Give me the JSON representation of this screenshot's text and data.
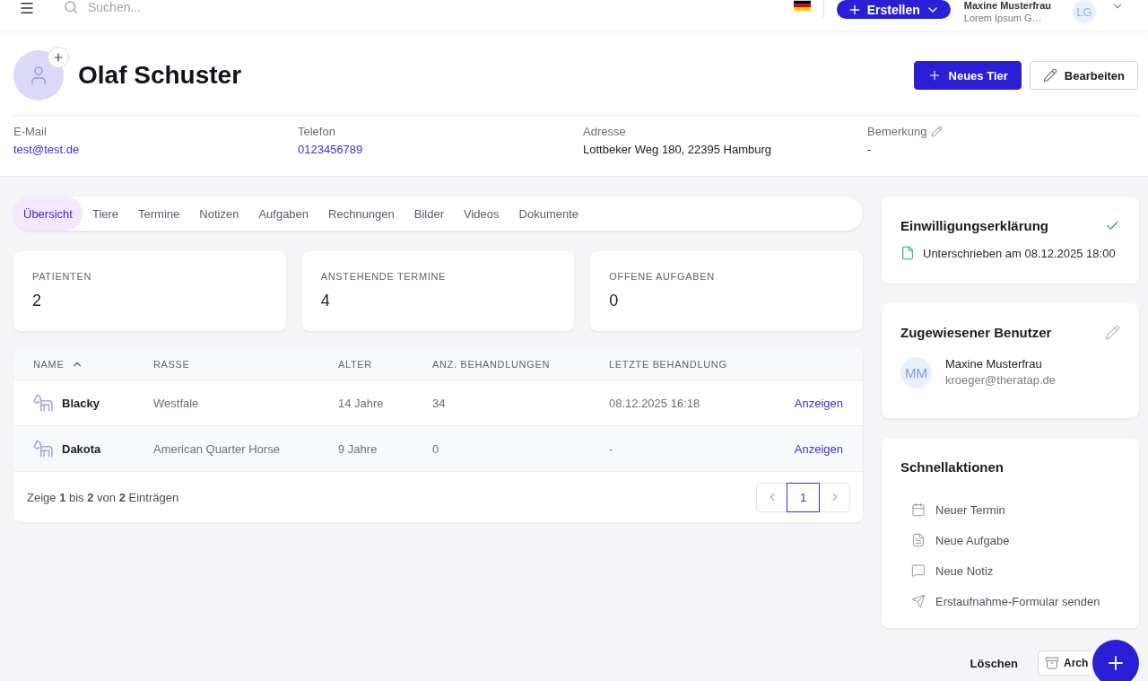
{
  "top_bar": {
    "search": {
      "placeholder": "Suchen..."
    },
    "create_button": "Erstellen",
    "user": {
      "name": "Maxine Musterfrau",
      "organization": "Lorem Ipsum G…",
      "initials": "LG"
    }
  },
  "client": {
    "name": "Olaf Schuster",
    "buttons": [
      {
        "label": "Neues Tier",
        "kind": "primary"
      },
      {
        "label": "Bearbeiten",
        "kind": "secondary"
      }
    ],
    "fields": [
      {
        "label": "E-Mail",
        "value": "test@test.de",
        "kind": "link",
        "editable": false
      },
      {
        "label": "Telefon",
        "value": "0123456789",
        "kind": "link",
        "editable": false
      },
      {
        "label": "Adresse",
        "value": "Lottbeker Weg 180, 22395 Hamburg",
        "kind": "text",
        "editable": false
      },
      {
        "label": "Bemerkung",
        "value": "-",
        "kind": "text",
        "editable": true
      }
    ]
  },
  "tabs": [
    {
      "label": "Übersicht",
      "selected": true
    },
    {
      "label": "Tiere",
      "selected": false
    },
    {
      "label": "Termine",
      "selected": false
    },
    {
      "label": "Notizen",
      "selected": false
    },
    {
      "label": "Aufgaben",
      "selected": false
    },
    {
      "label": "Rechnungen",
      "selected": false
    },
    {
      "label": "Bilder",
      "selected": false
    },
    {
      "label": "Videos",
      "selected": false
    },
    {
      "label": "Dokumente",
      "selected": false
    }
  ],
  "stats": [
    {
      "label": "PATIENTEN",
      "value": "2"
    },
    {
      "label": "ANSTEHENDE TERMINE",
      "value": "4"
    },
    {
      "label": "OFFENE AUFGABEN",
      "value": "0"
    }
  ],
  "table": {
    "columns": [
      {
        "label": "NAME",
        "sorted": true
      },
      {
        "label": "RASSE",
        "sorted": false
      },
      {
        "label": "ALTER",
        "sorted": false
      },
      {
        "label": "ANZ. BEHANDLUNGEN",
        "sorted": false
      },
      {
        "label": "LETZTE BEHANDLUNG",
        "sorted": false
      }
    ],
    "rows": [
      {
        "name": "Blacky",
        "breed": "Westfale",
        "age": "14 Jahre",
        "treatments": "34",
        "last_treatment": "08.12.2025 16:18",
        "action": "Anzeigen"
      },
      {
        "name": "Dakota",
        "breed": "American Quarter Horse",
        "age": "9 Jahre",
        "treatments": "0",
        "last_treatment": "-",
        "action": "Anzeigen"
      }
    ],
    "summary": "Zeige **1** bis **2** von **2** Einträgen",
    "pagination": {
      "pages": [
        {
          "label": "1",
          "selected": true
        }
      ]
    }
  },
  "consent": {
    "title": "Einwilligungserklärung",
    "signed": true,
    "text": "Unterschrieben am 08.12.2025 18:00"
  },
  "assigned_user": {
    "title": "Zugewiesener Benutzer",
    "initials": "MM",
    "name": "Maxine Musterfrau",
    "email": "kroeger@theratap.de"
  },
  "quick_actions": {
    "title": "Schnellaktionen",
    "items": [
      {
        "label": "Neuer Termin",
        "kind": "calendar"
      },
      {
        "label": "Neue Aufgabe",
        "kind": "task"
      },
      {
        "label": "Neue Notiz",
        "kind": "note"
      },
      {
        "label": "Erstaufnahme-Formular senden",
        "kind": "send"
      }
    ]
  },
  "footer_actions": {
    "delete": "Löschen",
    "archive": "Arch"
  }
}
